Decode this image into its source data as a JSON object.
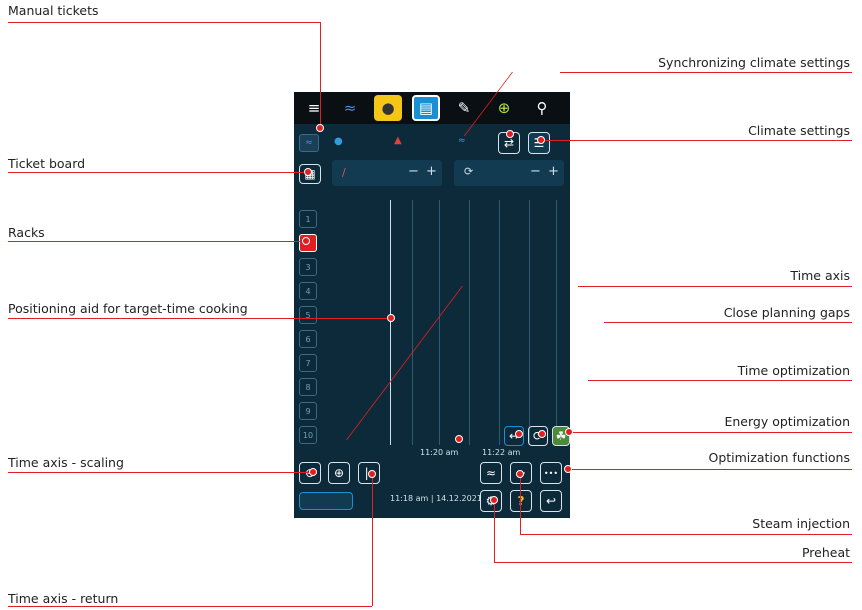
{
  "labels": {
    "manual_tickets": "Manual tickets",
    "ticket_board": "Ticket board",
    "racks": "Racks",
    "positioning_aid": "Positioning aid for target-time cooking",
    "time_axis_scaling": "Time axis - scaling",
    "time_axis_return": "Time axis - return",
    "sync_climate": "Synchronizing climate settings",
    "climate_settings": "Climate settings",
    "time_axis": "Time axis",
    "close_gaps": "Close planning gaps",
    "time_opt": "Time optimization",
    "energy_opt": "Energy optimization",
    "opt_functions": "Optimization functions",
    "steam_injection": "Steam injection",
    "preheat": "Preheat"
  },
  "screen": {
    "rack_numbers": [
      "1",
      "2",
      "3",
      "4",
      "5",
      "6",
      "7",
      "8",
      "9",
      "10"
    ],
    "time_labels": [
      "11:20 am",
      "11:22 am"
    ],
    "status_time": "11:18 am | 14.12.2021",
    "minus": "−",
    "plus": "+",
    "more": "•••",
    "help": "?"
  },
  "colors": {
    "accent": "#e02020",
    "screen_bg": "#0d2a3a",
    "active_tab": "#1a8fd1",
    "yellow": "#f5c518"
  }
}
